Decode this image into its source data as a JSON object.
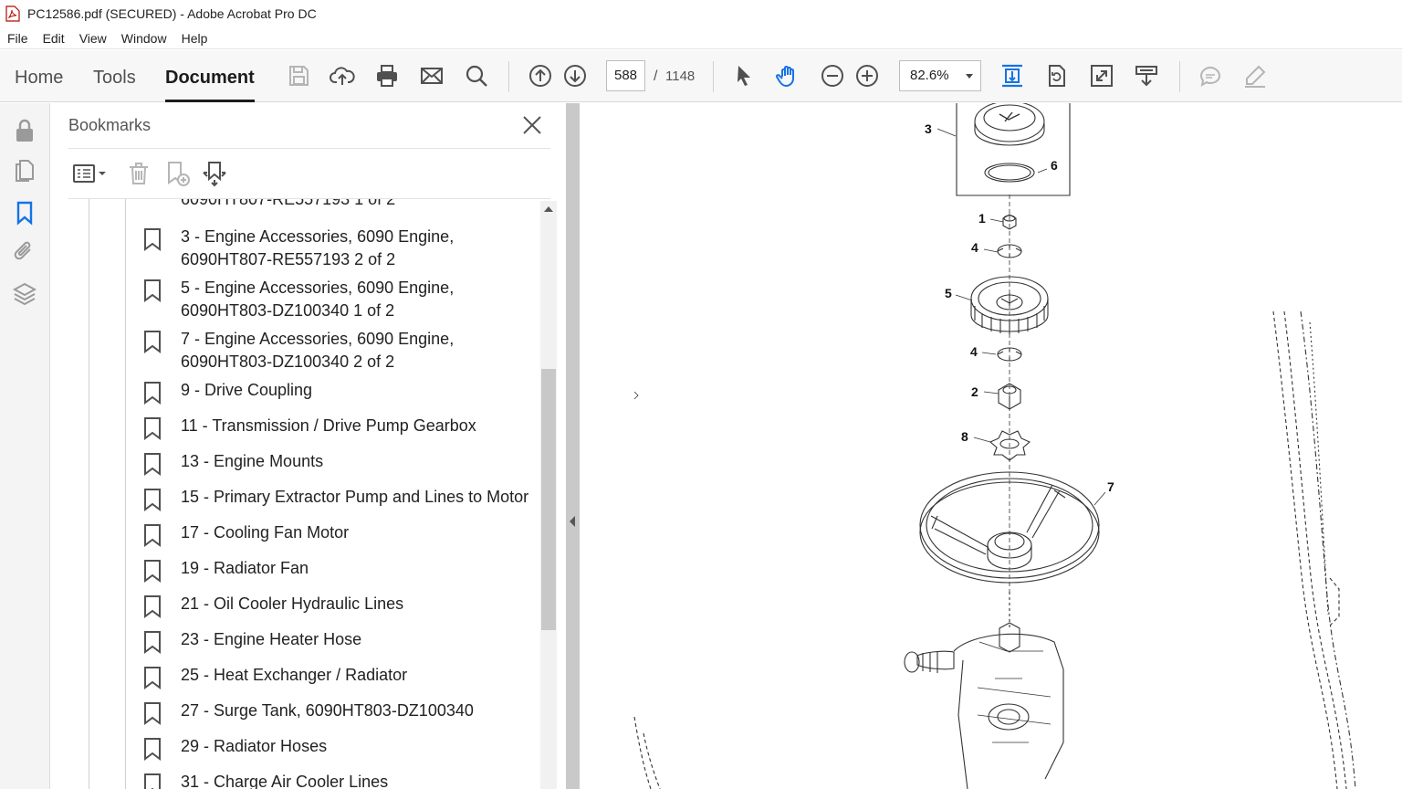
{
  "window": {
    "title": "PC12586.pdf (SECURED) - Adobe Acrobat Pro DC"
  },
  "menu": [
    "File",
    "Edit",
    "View",
    "Window",
    "Help"
  ],
  "nav_tabs": [
    {
      "label": "Home",
      "active": false
    },
    {
      "label": "Tools",
      "active": false
    },
    {
      "label": "Document",
      "active": true
    }
  ],
  "toolbar": {
    "icons": [
      "save-icon",
      "upload-icon",
      "print-icon",
      "email-icon",
      "search-icon",
      "page-up-icon",
      "page-down-icon",
      "select-cursor-icon",
      "hand-icon",
      "zoom-out-icon",
      "zoom-in-icon",
      "scroll-mode-icon",
      "rotate-icon",
      "fullscreen-icon",
      "read-mode-icon",
      "comment-icon",
      "draw-icon"
    ],
    "page_current": "588",
    "page_separator": "/",
    "page_total": "1148",
    "zoom": "82.6%"
  },
  "left_rail": [
    "lock-icon",
    "pages-icon",
    "bookmark-icon",
    "attachment-icon",
    "layers-icon"
  ],
  "bookmarks": {
    "header": "Bookmarks",
    "partial_top": "6090HT807-RE557193 1 of 2",
    "items": [
      "3 - Engine Accessories, 6090 Engine, 6090HT807-RE557193 2 of 2",
      "5 - Engine Accessories, 6090 Engine, 6090HT803-DZ100340 1 of 2",
      "7 - Engine Accessories, 6090 Engine, 6090HT803-DZ100340 2 of 2",
      "9 - Drive Coupling",
      "11 - Transmission / Drive Pump Gearbox",
      "13 - Engine Mounts",
      "15 - Primary Extractor Pump and Lines to Motor",
      "17 - Cooling Fan Motor",
      "19 - Radiator Fan",
      "21 - Oil Cooler Hydraulic Lines",
      "23 - Engine Heater Hose",
      "25 - Heat Exchanger / Radiator",
      "27 - Surge Tank, 6090HT803-DZ100340",
      "29 - Radiator Hoses",
      "31 - Charge Air Cooler Lines"
    ]
  },
  "drawing": {
    "callouts": [
      "3",
      "6",
      "1",
      "4",
      "5",
      "4",
      "2",
      "8",
      "7"
    ]
  }
}
